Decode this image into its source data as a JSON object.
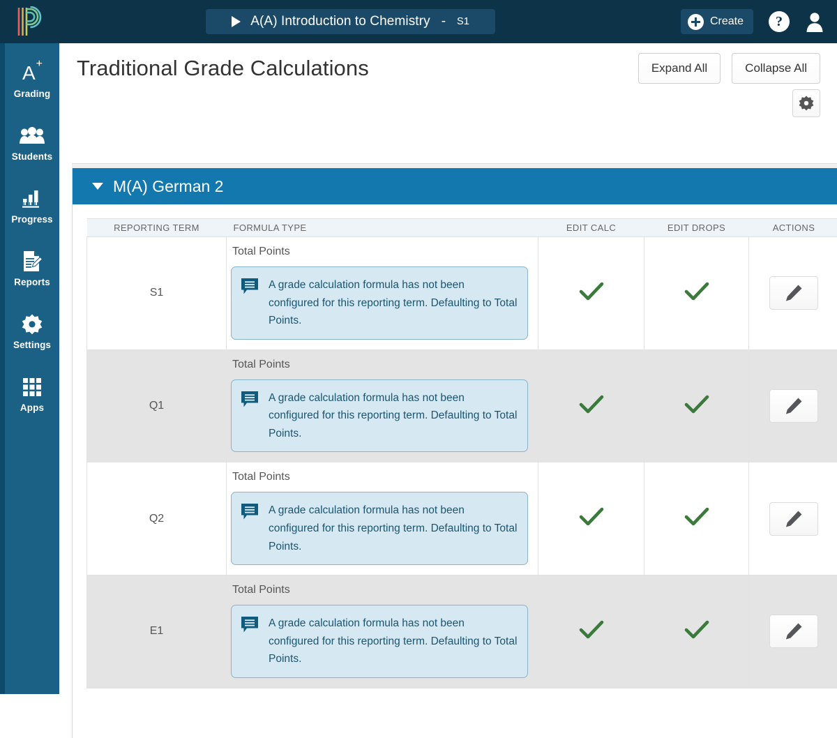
{
  "topbar": {
    "logo_name": "powerschool-logo",
    "course": {
      "play_icon": "play-icon",
      "name": "A(A) Introduction to Chemistry",
      "dash": "-",
      "term": "S1"
    },
    "create_label": "Create",
    "help_label": "?",
    "icons": {
      "create": "plus-circle-icon",
      "help": "help-icon",
      "user": "user-avatar-icon"
    }
  },
  "sidebar": {
    "items": [
      {
        "label": "Grading",
        "icon": "grade-a-plus-icon",
        "mark": "A",
        "sup": "+"
      },
      {
        "label": "Students",
        "icon": "students-icon"
      },
      {
        "label": "Progress",
        "icon": "bar-chart-icon"
      },
      {
        "label": "Reports",
        "icon": "report-document-icon"
      },
      {
        "label": "Settings",
        "icon": "gear-icon"
      },
      {
        "label": "Apps",
        "icon": "grid-apps-icon"
      }
    ]
  },
  "page": {
    "title": "Traditional Grade Calculations",
    "expand_all_label": "Expand All",
    "collapse_all_label": "Collapse All",
    "settings_icon": "gear-icon"
  },
  "section": {
    "caret_icon": "caret-down-icon",
    "title": "M(A) German 2"
  },
  "table": {
    "columns": [
      "REPORTING TERM",
      "FORMULA TYPE",
      "EDIT CALC",
      "EDIT DROPS",
      "ACTIONS"
    ],
    "rows": [
      {
        "term": "S1",
        "formula_type": "Total Points",
        "callout_icon": "note-bubble-icon",
        "callout_text": "A grade calculation formula has not been configured for this reporting term. Defaulting to Total Points.",
        "edit_calc": "✓",
        "edit_drops": "✓",
        "action_icon": "pencil-edit-icon"
      },
      {
        "term": "Q1",
        "formula_type": "Total Points",
        "callout_icon": "note-bubble-icon",
        "callout_text": "A grade calculation formula has not been configured for this reporting term. Defaulting to Total Points.",
        "edit_calc": "✓",
        "edit_drops": "✓",
        "action_icon": "pencil-edit-icon"
      },
      {
        "term": "Q2",
        "formula_type": "Total Points",
        "callout_icon": "note-bubble-icon",
        "callout_text": "A grade calculation formula has not been configured for this reporting term. Defaulting to Total Points.",
        "edit_calc": "✓",
        "edit_drops": "✓",
        "action_icon": "pencil-edit-icon"
      },
      {
        "term": "E1",
        "formula_type": "Total Points",
        "callout_icon": "note-bubble-icon",
        "callout_text": "A grade calculation formula has not been configured for this reporting term. Defaulting to Total Points.",
        "edit_calc": "✓",
        "edit_drops": "✓",
        "action_icon": "pencil-edit-icon"
      }
    ]
  },
  "colors": {
    "topbar_bg": "#0d3349",
    "sidebar_bg": "#1b6186",
    "sidebar_edge": "#0e4a6b",
    "section_header_bg": "#1278ae",
    "callout_bg": "#d6e9f2",
    "callout_border": "#87b4c8",
    "callout_text": "#1a5570",
    "check_green": "#3a7a3a",
    "row_alt_bg": "#e4e4e4"
  }
}
